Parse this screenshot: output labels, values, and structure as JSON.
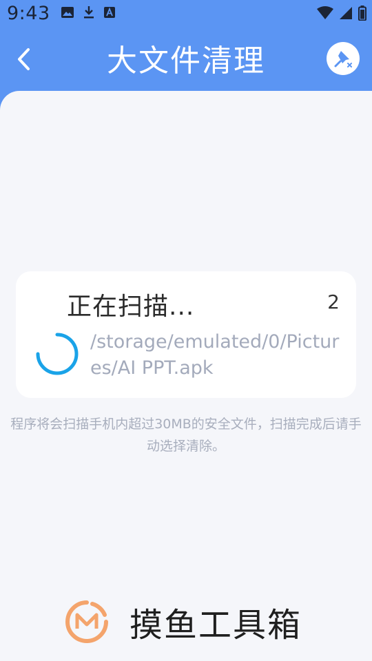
{
  "status": {
    "time": "9:43"
  },
  "header": {
    "title": "大文件清理"
  },
  "scan": {
    "title": "正在扫描...",
    "count": "2",
    "path": "/storage/emulated/0/Pictures/AI PPT.apk"
  },
  "hint": "程序将会扫描手机内超过30MB的安全文件，扫描完成后请手动选择清除。",
  "footer": {
    "app_name": "摸鱼工具箱"
  },
  "colors": {
    "accent": "#5b95f3",
    "spinner": "#1aa3e8",
    "logo": "#f4a46c"
  }
}
